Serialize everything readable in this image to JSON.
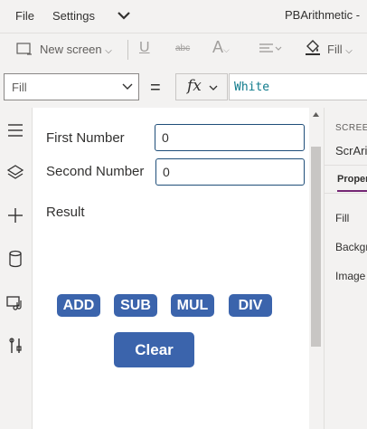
{
  "menu": {
    "file": "File",
    "settings": "Settings",
    "app_title": "PBArithmetic -"
  },
  "toolbar": {
    "new_screen": "New screen",
    "fill": "Fill"
  },
  "formula_bar": {
    "property": "Fill",
    "equals": "=",
    "fx": "fx",
    "formula": "White"
  },
  "canvas": {
    "first_number_label": "First Number",
    "first_number_value": "0",
    "second_number_label": "Second Number",
    "second_number_value": "0",
    "result_label": "Result",
    "buttons": {
      "add": "ADD",
      "sub": "SUB",
      "mul": "MUL",
      "div": "DIV",
      "clear": "Clear"
    }
  },
  "right_panel": {
    "section": "SCREEN",
    "screen_name": "ScrAri",
    "tab": "Proper",
    "properties": [
      "Fill",
      "Backgr",
      "Image"
    ]
  },
  "colors": {
    "button": "#3b64ac",
    "input_border": "#1f4e79",
    "formula_text": "#0e7a8b",
    "accent": "#742774"
  }
}
